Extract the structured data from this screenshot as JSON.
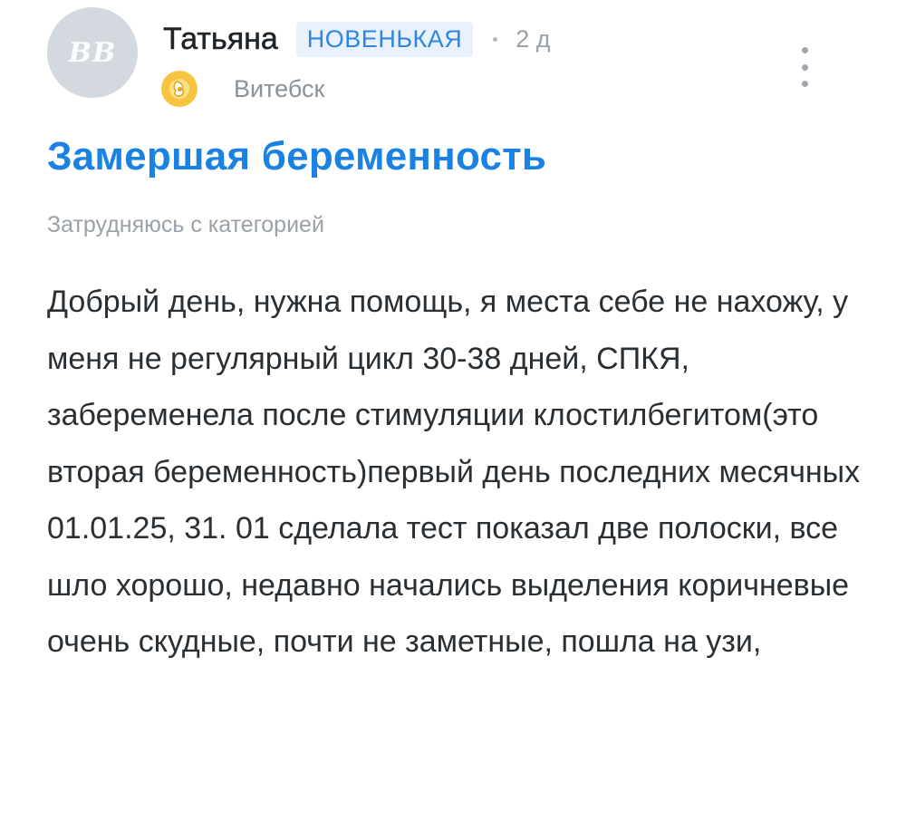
{
  "post": {
    "author": {
      "avatar_initials": "BB",
      "name": "Татьяна",
      "badge": "НОВЕНЬКАЯ",
      "time": "2 д",
      "city": "Витебск",
      "status_icon": "pregnancy-icon"
    },
    "title": "Замершая беременность",
    "category": "Затрудняюсь с категорией",
    "body": "Добрый день, нужна помощь, я места себе не нахожу, у меня не регулярный цикл 30-38 дней, СПКЯ, забеременела после стимуляции клостилбегитом(это вторая беременность)первый день последних месячных 01.01.25, 31. 01 сделала тест показал две полоски, все шло хорошо, недавно начались выделения коричневые очень скудные, почти не заметные, пошла на узи,"
  },
  "colors": {
    "title": "#1a82e2",
    "badge_bg": "#e9f2fc",
    "badge_text": "#2f86de",
    "muted": "#9aa1a8",
    "avatar_bg": "#d3d9df",
    "icon_yellow": "#f6c43e"
  }
}
